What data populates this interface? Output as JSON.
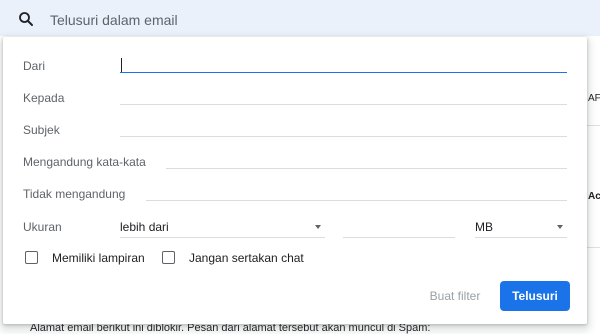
{
  "search": {
    "placeholder": "Telusuri dalam email"
  },
  "background": {
    "right_text_1": "AF",
    "right_text_2": "Ac",
    "footer_text": "Alamat email berikut ini diblokir. Pesan dari alamat tersebut akan muncul di Spam:"
  },
  "form": {
    "from_label": "Dari",
    "from_value": "",
    "to_label": "Kepada",
    "to_value": "",
    "subject_label": "Subjek",
    "subject_value": "",
    "has_words_label": "Mengandung kata-kata",
    "has_words_value": "",
    "doesnt_have_label": "Tidak mengandung",
    "doesnt_have_value": "",
    "size_label": "Ukuran",
    "size_operator": "lebih dari",
    "size_value": "",
    "size_unit": "MB",
    "has_attachment_label": "Memiliki lampiran",
    "has_attachment_checked": false,
    "exclude_chats_label": "Jangan sertakan chat",
    "exclude_chats_checked": false
  },
  "actions": {
    "create_filter_label": "Buat filter",
    "search_label": "Telusuri"
  },
  "colors": {
    "search_bar_bg": "#eaf1fb",
    "primary": "#1a73e8",
    "disabled_text": "#9aa0a6"
  }
}
